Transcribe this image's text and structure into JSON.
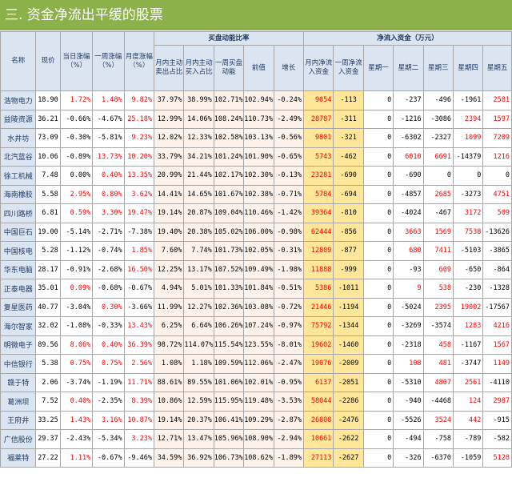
{
  "title": "三. 资金净流出平缓的股票",
  "groups": {
    "buy_ratio": "买盘动能比率",
    "net_inflow": "净流入资金（万元）"
  },
  "columns": {
    "name": "名称",
    "price": "现价",
    "day_chg": "当日涨幅（%）",
    "week_chg": "一周涨幅（%）",
    "month_chg": "月度涨幅（%）",
    "active_sell": "月内主动卖出占比",
    "active_buy": "月内主动买入占比",
    "week_buy_power": "一周买盘动能",
    "prev_value": "前值",
    "growth": "增长",
    "month_net": "月内净流入资金",
    "week_net": "一周净流入资金",
    "mon": "星期一",
    "tue": "星期二",
    "wed": "星期三",
    "thu": "星期四",
    "fri": "星期五"
  },
  "rows": [
    {
      "name": "浩物电力",
      "price": "18.90",
      "day": "1.72%",
      "week": "1.48%",
      "month": "9.82%",
      "sell": "37.97%",
      "buy": "38.99%",
      "wbp": "102.71%",
      "prev": "102.94%",
      "growth": "-0.24%",
      "mnet": "9054",
      "wnet": "-113",
      "mon": "0",
      "tue": "-237",
      "wed": "-496",
      "thu": "-1961",
      "fri": "2581"
    },
    {
      "name": "益陵资源",
      "price": "36.21",
      "day": "-0.66%",
      "week": "-4.67%",
      "month": "25.18%",
      "sell": "12.99%",
      "buy": "14.06%",
      "wbp": "108.24%",
      "prev": "110.73%",
      "growth": "-2.49%",
      "mnet": "28787",
      "wnet": "-311",
      "mon": "0",
      "tue": "-1216",
      "wed": "-3086",
      "thu": "2394",
      "fri": "1597"
    },
    {
      "name": "水井坊",
      "price": "73.09",
      "day": "-0.30%",
      "week": "-5.81%",
      "month": "9.23%",
      "sell": "12.02%",
      "buy": "12.33%",
      "wbp": "102.58%",
      "prev": "103.13%",
      "growth": "-0.56%",
      "mnet": "9801",
      "wnet": "-321",
      "mon": "0",
      "tue": "-6302",
      "wed": "-2327",
      "thu": "1099",
      "fri": "7209"
    },
    {
      "name": "北汽蓝谷",
      "price": "10.06",
      "day": "-0.89%",
      "week": "13.73%",
      "month": "10.20%",
      "sell": "33.79%",
      "buy": "34.21%",
      "wbp": "101.24%",
      "prev": "101.90%",
      "growth": "-0.65%",
      "mnet": "5743",
      "wnet": "-462",
      "mon": "0",
      "tue": "6010",
      "wed": "6691",
      "thu": "-14379",
      "fri": "1216"
    },
    {
      "name": "徐工机械",
      "price": "7.48",
      "day": "0.00%",
      "week": "0.40%",
      "month": "13.35%",
      "sell": "20.99%",
      "buy": "21.44%",
      "wbp": "102.17%",
      "prev": "102.30%",
      "growth": "-0.13%",
      "mnet": "23281",
      "wnet": "-690",
      "mon": "0",
      "tue": "-690",
      "wed": "0",
      "thu": "0",
      "fri": "0"
    },
    {
      "name": "海南橡胶",
      "price": "5.58",
      "day": "2.95%",
      "week": "0.80%",
      "month": "3.62%",
      "sell": "14.41%",
      "buy": "14.65%",
      "wbp": "101.67%",
      "prev": "102.38%",
      "growth": "-0.71%",
      "mnet": "5784",
      "wnet": "-694",
      "mon": "0",
      "tue": "-4857",
      "wed": "2685",
      "thu": "-3273",
      "fri": "4751"
    },
    {
      "name": "四川路桥",
      "price": "6.81",
      "day": "0.59%",
      "week": "3.30%",
      "month": "19.47%",
      "sell": "19.14%",
      "buy": "20.87%",
      "wbp": "109.04%",
      "prev": "110.46%",
      "growth": "-1.42%",
      "mnet": "39364",
      "wnet": "-810",
      "mon": "0",
      "tue": "-4024",
      "wed": "-467",
      "thu": "3172",
      "fri": "509"
    },
    {
      "name": "中国巨石",
      "price": "19.00",
      "day": "-5.14%",
      "week": "-2.71%",
      "month": "-7.38%",
      "sell": "19.40%",
      "buy": "20.38%",
      "wbp": "105.02%",
      "prev": "106.00%",
      "growth": "-0.98%",
      "mnet": "62444",
      "wnet": "-856",
      "mon": "0",
      "tue": "3663",
      "wed": "1569",
      "thu": "7538",
      "fri": "-13626"
    },
    {
      "name": "中国核电",
      "price": "5.28",
      "day": "-1.12%",
      "week": "-0.74%",
      "month": "1.85%",
      "sell": "7.60%",
      "buy": "7.74%",
      "wbp": "101.73%",
      "prev": "102.05%",
      "growth": "-0.31%",
      "mnet": "12809",
      "wnet": "-877",
      "mon": "0",
      "tue": "680",
      "wed": "7411",
      "thu": "-5103",
      "fri": "-3865"
    },
    {
      "name": "华东电脑",
      "price": "28.17",
      "day": "-0.91%",
      "week": "-2.68%",
      "month": "16.50%",
      "sell": "12.25%",
      "buy": "13.17%",
      "wbp": "107.52%",
      "prev": "109.49%",
      "growth": "-1.98%",
      "mnet": "11888",
      "wnet": "-999",
      "mon": "0",
      "tue": "-93",
      "wed": "609",
      "thu": "-650",
      "fri": "-864"
    },
    {
      "name": "正泰电器",
      "price": "35.01",
      "day": "0.09%",
      "week": "-0.68%",
      "month": "-0.67%",
      "sell": "4.94%",
      "buy": "5.01%",
      "wbp": "101.33%",
      "prev": "101.84%",
      "growth": "-0.51%",
      "mnet": "5386",
      "wnet": "-1011",
      "mon": "0",
      "tue": "9",
      "wed": "538",
      "thu": "-230",
      "fri": "-1328"
    },
    {
      "name": "复星医药",
      "price": "40.77",
      "day": "-3.04%",
      "week": "0.30%",
      "month": "-3.66%",
      "sell": "11.99%",
      "buy": "12.27%",
      "wbp": "102.36%",
      "prev": "103.08%",
      "growth": "-0.72%",
      "mnet": "21446",
      "wnet": "-1194",
      "mon": "0",
      "tue": "-5024",
      "wed": "2395",
      "thu": "19002",
      "fri": "-17567"
    },
    {
      "name": "海尔智家",
      "price": "32.02",
      "day": "-1.08%",
      "week": "-0.33%",
      "month": "13.43%",
      "sell": "6.25%",
      "buy": "6.64%",
      "wbp": "106.26%",
      "prev": "107.24%",
      "growth": "-0.97%",
      "mnet": "75792",
      "wnet": "-1344",
      "mon": "0",
      "tue": "-3269",
      "wed": "-3574",
      "thu": "1283",
      "fri": "4216"
    },
    {
      "name": "明微电子",
      "price": "89.56",
      "day": "8.06%",
      "week": "0.40%",
      "month": "36.39%",
      "sell": "98.72%",
      "buy": "114.07%",
      "wbp": "115.54%",
      "prev": "123.55%",
      "growth": "-8.01%",
      "mnet": "19602",
      "wnet": "-1460",
      "mon": "0",
      "tue": "-2318",
      "wed": "458",
      "thu": "-1167",
      "fri": "1567"
    },
    {
      "name": "中信银行",
      "price": "5.38",
      "day": "0.75%",
      "week": "0.75%",
      "month": "2.56%",
      "sell": "1.08%",
      "buy": "1.18%",
      "wbp": "109.59%",
      "prev": "112.06%",
      "growth": "-2.47%",
      "mnet": "19076",
      "wnet": "-2009",
      "mon": "0",
      "tue": "108",
      "wed": "481",
      "thu": "-3747",
      "fri": "1149"
    },
    {
      "name": "赣于特",
      "price": "2.06",
      "day": "-3.74%",
      "week": "-1.19%",
      "month": "11.71%",
      "sell": "88.61%",
      "buy": "89.55%",
      "wbp": "101.06%",
      "prev": "102.01%",
      "growth": "-0.95%",
      "mnet": "6137",
      "wnet": "-2051",
      "mon": "0",
      "tue": "-5310",
      "wed": "4807",
      "thu": "2561",
      "fri": "-4110"
    },
    {
      "name": "葛洲坝",
      "price": "7.52",
      "day": "0.40%",
      "week": "-2.35%",
      "month": "8.39%",
      "sell": "10.86%",
      "buy": "12.59%",
      "wbp": "115.95%",
      "prev": "119.48%",
      "growth": "-3.53%",
      "mnet": "58044",
      "wnet": "-2286",
      "mon": "0",
      "tue": "-940",
      "wed": "-4468",
      "thu": "124",
      "fri": "2987"
    },
    {
      "name": "王府井",
      "price": "33.25",
      "day": "1.43%",
      "week": "3.16%",
      "month": "10.87%",
      "sell": "19.14%",
      "buy": "20.37%",
      "wbp": "106.41%",
      "prev": "109.29%",
      "growth": "-2.87%",
      "mnet": "26808",
      "wnet": "-2476",
      "mon": "0",
      "tue": "-5526",
      "wed": "3524",
      "thu": "442",
      "fri": "-915"
    },
    {
      "name": "广信股份",
      "price": "29.37",
      "day": "-2.43%",
      "week": "-5.34%",
      "month": "3.23%",
      "sell": "12.71%",
      "buy": "13.47%",
      "wbp": "105.96%",
      "prev": "108.90%",
      "growth": "-2.94%",
      "mnet": "10661",
      "wnet": "-2622",
      "mon": "0",
      "tue": "-494",
      "wed": "-758",
      "thu": "-789",
      "fri": "-582"
    },
    {
      "name": "福莱特",
      "price": "27.22",
      "day": "1.11%",
      "week": "-0.67%",
      "month": "-9.46%",
      "sell": "34.59%",
      "buy": "36.92%",
      "wbp": "106.73%",
      "prev": "108.62%",
      "growth": "-1.89%",
      "mnet": "27113",
      "wnet": "-2627",
      "mon": "0",
      "tue": "-326",
      "wed": "-6370",
      "thu": "-1059",
      "fri": "5128"
    }
  ]
}
